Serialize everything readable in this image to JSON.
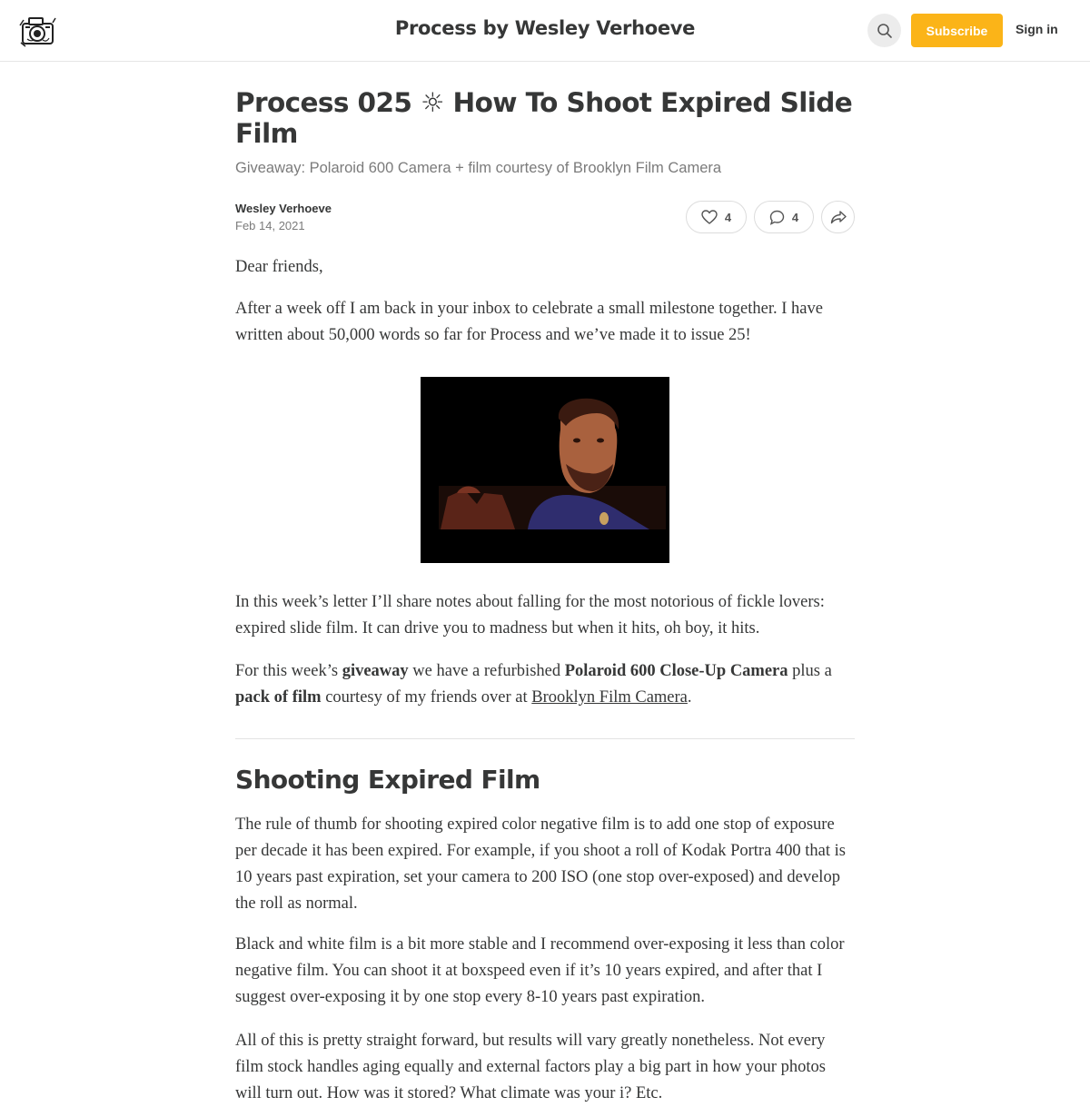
{
  "header": {
    "site_title": "Process by Wesley Verhoeve",
    "subscribe_label": "Subscribe",
    "signin_label": "Sign in"
  },
  "post": {
    "title": "Process 025 ☼ How To Shoot Expired Slide Film",
    "subtitle": "Giveaway: Polaroid 600 Camera + film courtesy of Brooklyn Film Camera",
    "author": "Wesley Verhoeve",
    "date": "Feb 14, 2021",
    "like_count": "4",
    "comment_count": "4"
  },
  "body": {
    "greeting": "Dear friends,",
    "intro": "After a week off I am back in your inbox to celebrate a small milestone together. I have written about 50,000 words so far for Process and we’ve made it to issue 25!",
    "letter": "In this week’s letter I’ll share notes about falling for the most notorious of fickle lovers: expired slide film. It can drive you to madness but when it hits, oh boy, it hits.",
    "giveaway": {
      "t1": "For this week’s ",
      "b1": "giveaway",
      "t2": " we have a refurbished ",
      "b2": "Polaroid 600 Close-Up Camera",
      "t3": " plus a ",
      "b3": "pack of film",
      "t4": " courtesy of my friends over at ",
      "link": "Brooklyn Film Camera",
      "t5": "."
    },
    "section_heading": "Shooting Expired Film",
    "rule": "The rule of thumb for shooting expired color negative film is to add one stop of exposure per decade it has been expired. For example, if you shoot a roll of Kodak Portra 400 that is 10 years past expiration, set your camera to 200 ISO (one stop over-exposed) and develop the roll as normal.",
    "bw": "Black and white film is a bit more stable and I recommend over-exposing it less than color negative film. You can shoot it at boxspeed even if it’s 10 years expired, and after that I suggest over-exposing it by one stop every 8-10 years past expiration.",
    "all": "All of this is pretty straight forward, but results will vary greatly nonetheless. Not every film stock handles aging equally and external factors play a big part in how your photos will turn out. How was it stored? What climate was your i? Etc."
  },
  "icons": {
    "logo": "camera-logo-icon",
    "search": "search-icon",
    "like": "heart-icon",
    "comment": "comment-icon",
    "share": "share-icon"
  },
  "colors": {
    "accent": "#fbb418",
    "text": "#363737",
    "muted": "#7b7b7b"
  }
}
